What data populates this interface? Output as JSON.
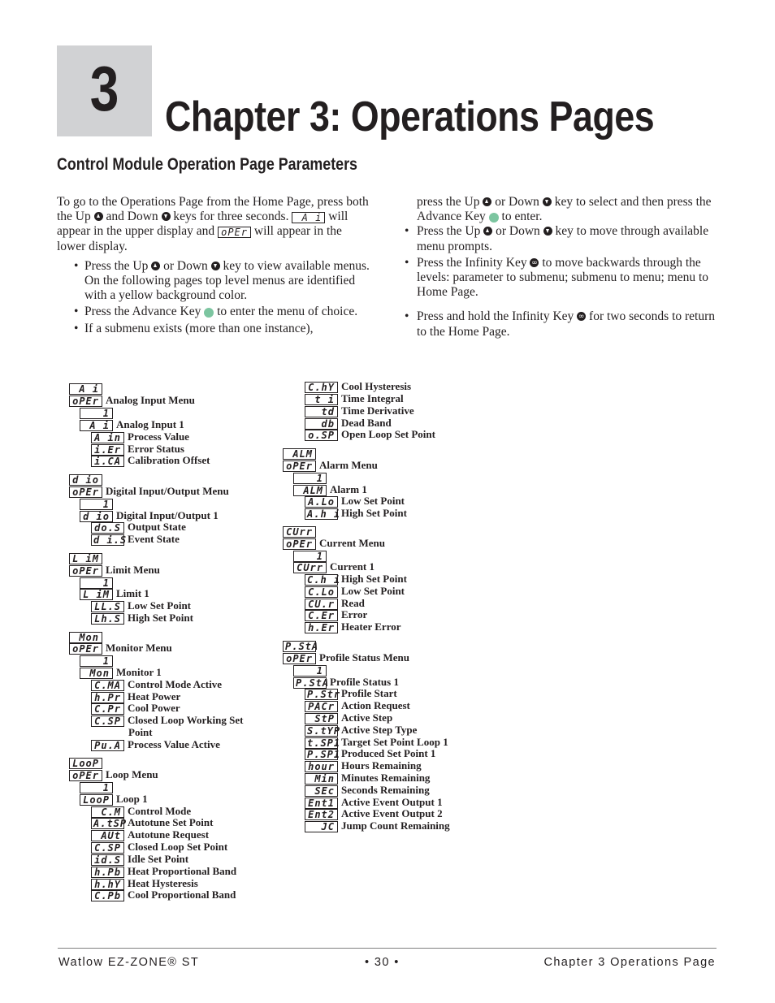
{
  "chapter": {
    "number": "3",
    "title": "Chapter 3: Operations Pages"
  },
  "section_title": "Control Module Operation Page Parameters",
  "intro": {
    "para_part1": "To go to the Operations Page from the Home Page, press both the Up",
    "para_part2": "and Down",
    "para_part3": "keys for three seconds.",
    "upper_display": "A i",
    "para_part4": "will appear in the upper display and",
    "lower_display": "oPEr",
    "para_part5": "will appear in the lower display.",
    "bullets_left": [
      {
        "a": "Press the Up",
        "b": "or Down",
        "c": "key to view available menus. On the following pages top level menus are identified with a yellow background color."
      },
      {
        "a": "Press the Advance Key",
        "b": "to enter the menu of choice."
      },
      {
        "a": "If a submenu exists (more than one instance),"
      }
    ],
    "right_cont": {
      "a": "press the Up",
      "b": "or Down",
      "c": "key to select and then press the Advance Key",
      "d": "to enter."
    },
    "bullets_right": [
      {
        "a": "Press the Up",
        "b": "or Down",
        "c": "key to move through available menu prompts."
      },
      {
        "a": "Press the Infinity Key",
        "b": "to move backwards through the levels: parameter to submenu; submenu to menu; menu to Home Page."
      },
      {
        "a": "Press and hold the Infinity Key",
        "b": "for two seconds to return to the Home Page."
      }
    ]
  },
  "icons": {
    "up_key": "up-arrow-key-icon",
    "down_key": "down-arrow-key-icon",
    "advance_key": "advance-key-icon",
    "infinity_key": "infinity-key-icon"
  },
  "menu_tree": [
    {
      "code": "A i",
      "label": ""
    },
    {
      "code": "oPEr",
      "label": "Analog Input Menu"
    },
    {
      "code": "1",
      "label": ""
    },
    {
      "code": "A i",
      "label": "Analog Input 1"
    },
    {
      "code": "A in",
      "label": "Process Value"
    },
    {
      "code": "i.Er",
      "label": "Error Status"
    },
    {
      "code": "i.CA",
      "label": "Calibration Offset"
    },
    {
      "code": "d io",
      "label": ""
    },
    {
      "code": "oPEr",
      "label": "Digital Input/Output Menu"
    },
    {
      "code": "1",
      "label": ""
    },
    {
      "code": "d io",
      "label": "Digital Input/Output 1"
    },
    {
      "code": "do.S",
      "label": "Output State"
    },
    {
      "code": "d i.S",
      "label": "Event State"
    },
    {
      "code": "L iM",
      "label": ""
    },
    {
      "code": "oPEr",
      "label": "Limit Menu"
    },
    {
      "code": "1",
      "label": ""
    },
    {
      "code": "L iM",
      "label": "Limit 1"
    },
    {
      "code": "LL.S",
      "label": "Low Set Point"
    },
    {
      "code": "Lh.S",
      "label": "High Set Point"
    },
    {
      "code": "Mon",
      "label": ""
    },
    {
      "code": "oPEr",
      "label": "Monitor Menu"
    },
    {
      "code": "1",
      "label": ""
    },
    {
      "code": "Mon",
      "label": "Monitor 1"
    },
    {
      "code": "C.MA",
      "label": "Control Mode Active"
    },
    {
      "code": "h.Pr",
      "label": "Heat Power"
    },
    {
      "code": "C.Pr",
      "label": "Cool Power"
    },
    {
      "code": "C.SP",
      "label": "Closed Loop Working Set"
    },
    {
      "code": "",
      "label": "Point"
    },
    {
      "code": "Pu.A",
      "label": "Process Value Active"
    },
    {
      "code": "LooP",
      "label": ""
    },
    {
      "code": "oPEr",
      "label": "Loop Menu"
    },
    {
      "code": "1",
      "label": ""
    },
    {
      "code": "LooP",
      "label": "Loop 1"
    },
    {
      "code": "C.M",
      "label": "Control Mode"
    },
    {
      "code": "A.tSP",
      "label": "Autotune Set Point"
    },
    {
      "code": "AUt",
      "label": "Autotune Request"
    },
    {
      "code": "C.SP",
      "label": "Closed Loop Set Point"
    },
    {
      "code": "id.S",
      "label": "Idle Set Point"
    },
    {
      "code": "h.Pb",
      "label": "Heat Proportional Band"
    },
    {
      "code": "h.hY",
      "label": "Heat Hysteresis"
    },
    {
      "code": "C.Pb",
      "label": "Cool Proportional Band"
    },
    {
      "code": "C.hY",
      "label": "Cool Hysteresis"
    },
    {
      "code": "t i",
      "label": "Time Integral"
    },
    {
      "code": "td",
      "label": "Time Derivative"
    },
    {
      "code": "db",
      "label": "Dead Band"
    },
    {
      "code": "o.SP",
      "label": "Open Loop Set Point"
    },
    {
      "code": "ALM",
      "label": ""
    },
    {
      "code": "oPEr",
      "label": "Alarm Menu"
    },
    {
      "code": "1",
      "label": ""
    },
    {
      "code": "ALM",
      "label": "Alarm 1"
    },
    {
      "code": "A.Lo",
      "label": "Low Set Point"
    },
    {
      "code": "A.h i",
      "label": "High Set Point"
    },
    {
      "code": "CUrr",
      "label": ""
    },
    {
      "code": "oPEr",
      "label": "Current Menu"
    },
    {
      "code": "1",
      "label": ""
    },
    {
      "code": "CUrr",
      "label": "Current 1"
    },
    {
      "code": "C.h i",
      "label": "High Set Point"
    },
    {
      "code": "C.Lo",
      "label": "Low Set Point"
    },
    {
      "code": "CU.r",
      "label": "Read"
    },
    {
      "code": "C.Er",
      "label": "Error"
    },
    {
      "code": "h.Er",
      "label": "Heater Error"
    },
    {
      "code": "P.StA",
      "label": ""
    },
    {
      "code": "oPEr",
      "label": "Profile Status Menu"
    },
    {
      "code": "1",
      "label": ""
    },
    {
      "code": "P.StA",
      "label": "Profile Status 1"
    },
    {
      "code": "P.Str",
      "label": "Profile Start"
    },
    {
      "code": "PACr",
      "label": "Action Request"
    },
    {
      "code": "StP",
      "label": "Active Step"
    },
    {
      "code": "S.tYP",
      "label": "Active Step Type"
    },
    {
      "code": "t.SP1",
      "label": "Target Set Point Loop 1"
    },
    {
      "code": "P.SP1",
      "label": "Produced Set Point 1"
    },
    {
      "code": "hour",
      "label": "Hours Remaining"
    },
    {
      "code": "Min",
      "label": "Minutes Remaining"
    },
    {
      "code": "SEc",
      "label": "Seconds Remaining"
    },
    {
      "code": "Ent1",
      "label": "Active Event Output 1"
    },
    {
      "code": "Ent2",
      "label": "Active Event Output 2"
    },
    {
      "code": "JC",
      "label": "Jump Count Remaining"
    }
  ],
  "footer": {
    "left": "Watlow EZ-ZONE® ST",
    "center": "•  30  •",
    "right": "Chapter 3 Operations Page"
  }
}
